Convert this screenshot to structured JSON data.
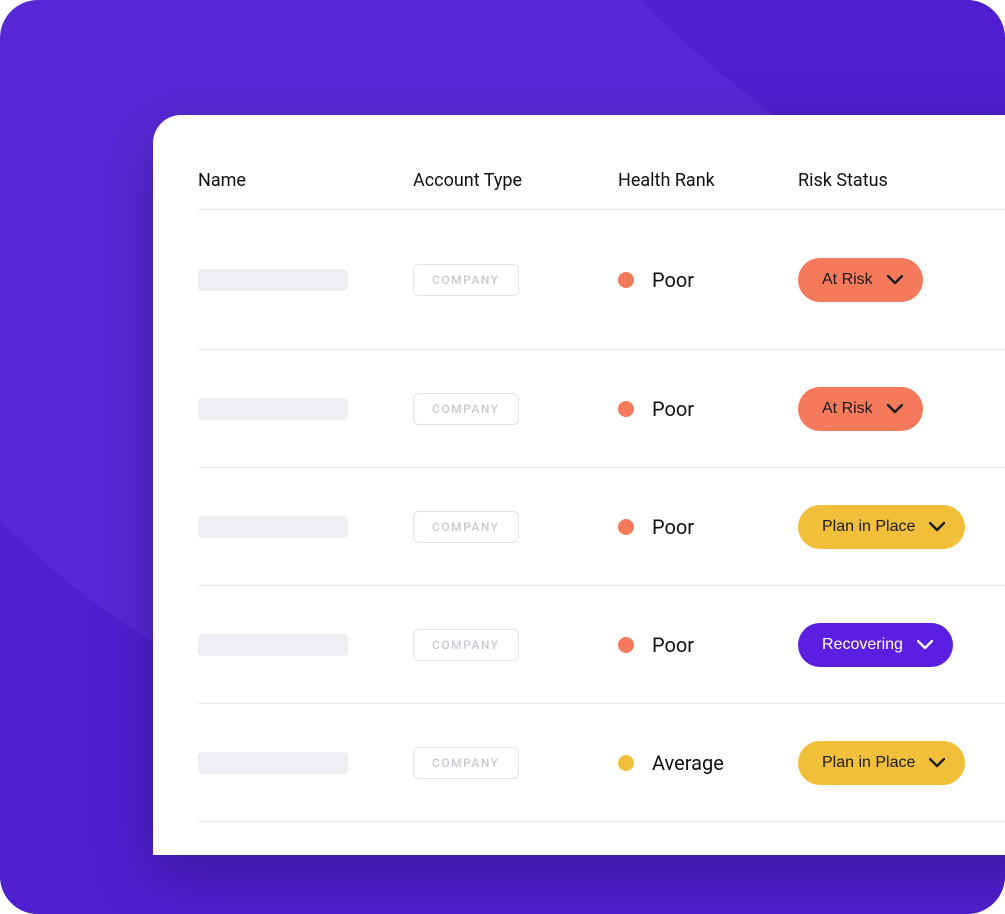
{
  "table": {
    "headers": {
      "name": "Name",
      "type": "Account Type",
      "health": "Health Rank",
      "risk": "Risk Status"
    },
    "rows": [
      {
        "type_label": "COMPANY",
        "health_label": "Poor",
        "health_class": "poor",
        "risk_label": "At Risk",
        "risk_class": "risk-atrisk"
      },
      {
        "type_label": "COMPANY",
        "health_label": "Poor",
        "health_class": "poor",
        "risk_label": "At Risk",
        "risk_class": "risk-atrisk"
      },
      {
        "type_label": "COMPANY",
        "health_label": "Poor",
        "health_class": "poor",
        "risk_label": "Plan in Place",
        "risk_class": "risk-plan"
      },
      {
        "type_label": "COMPANY",
        "health_label": "Poor",
        "health_class": "poor",
        "risk_label": "Recovering",
        "risk_class": "risk-recovering"
      },
      {
        "type_label": "COMPANY",
        "health_label": "Average",
        "health_class": "average",
        "risk_label": "Plan in Place",
        "risk_class": "risk-plan"
      }
    ]
  }
}
